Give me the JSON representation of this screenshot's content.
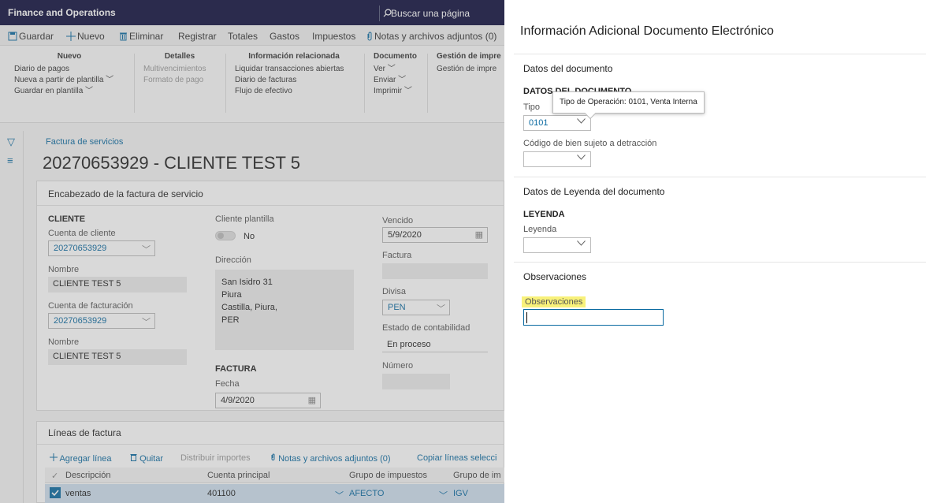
{
  "topbar": {
    "app_title": "Finance and Operations",
    "search_placeholder": "Buscar una página"
  },
  "actionbar": {
    "save": "Guardar",
    "new": "Nuevo",
    "delete": "Eliminar",
    "register": "Registrar",
    "totals": "Totales",
    "expenses": "Gastos",
    "taxes": "Impuestos",
    "notes": "Notas y archivos adjuntos (0)"
  },
  "ribbon": {
    "groups": [
      {
        "header": "Nuevo",
        "items": [
          "Diario de pagos",
          "Nueva a partir de plantilla ﹀",
          "Guardar en plantilla ﹀"
        ]
      },
      {
        "header": "Detalles",
        "items": [
          "Multivencimientos",
          "Formato de pago"
        ]
      },
      {
        "header": "Información relacionada",
        "items": [
          "Liquidar transacciones abiertas",
          "Diario de facturas",
          "Flujo de efectivo"
        ]
      },
      {
        "header": "Documento",
        "items": [
          "Ver ﹀",
          "Enviar ﹀",
          "Imprimir ﹀"
        ]
      },
      {
        "header": "Gestión de impre",
        "items": [
          "Gestión de impre"
        ]
      }
    ]
  },
  "page": {
    "breadcrumb": "Factura de servicios",
    "title": "20270653929 - CLIENTE TEST 5"
  },
  "header_card": {
    "title": "Encabezado de la factura de servicio",
    "cliente_section": "CLIENTE",
    "cuenta_cliente_label": "Cuenta de cliente",
    "cuenta_cliente_value": "20270653929",
    "nombre_label": "Nombre",
    "nombre_value": "CLIENTE TEST 5",
    "cuenta_facturacion_label": "Cuenta de facturación",
    "cuenta_facturacion_value": "20270653929",
    "nombre2_label": "Nombre",
    "nombre2_value": "CLIENTE TEST 5",
    "cliente_plantilla_label": "Cliente plantilla",
    "cliente_plantilla_value": "No",
    "direccion_label": "Dirección",
    "direccion_lines": [
      "San Isidro 31",
      "Piura",
      "Castilla, Piura,",
      "PER"
    ],
    "factura_section": "FACTURA",
    "fecha_label": "Fecha",
    "fecha_value": "4/9/2020",
    "vencido_label": "Vencido",
    "vencido_value": "5/9/2020",
    "factura_label": "Factura",
    "divisa_label": "Divisa",
    "divisa_value": "PEN",
    "estado_label": "Estado de contabilidad",
    "estado_value": "En proceso",
    "numero_label": "Número"
  },
  "lines_card": {
    "title": "Líneas de factura",
    "actions": {
      "add": "Agregar línea",
      "remove": "Quitar",
      "distribute": "Distribuir importes",
      "notes": "Notas y archivos adjuntos (0)",
      "copy": "Copiar líneas selecci"
    },
    "columns": [
      "Descripción",
      "Cuenta principal",
      "Grupo de impuestos",
      "Grupo de im"
    ],
    "rows": [
      {
        "descripcion": "ventas",
        "cuenta": "401100",
        "grupo_impuestos": "AFECTO",
        "grupo_im": "IGV"
      }
    ]
  },
  "panel": {
    "title": "Información Adicional Documento Electrónico",
    "datos_documento": "Datos del documento",
    "datos_documento_group": "DATOS DEL DOCUMENTO",
    "tipo_label": "Tipo",
    "tipo_value": "0101",
    "tooltip": "Tipo de Operación: 0101, Venta Interna",
    "codigo_label": "Código de bien sujeto a detracción",
    "codigo_value": "",
    "leyenda_section": "Datos de Leyenda del documento",
    "leyenda_group": "LEYENDA",
    "leyenda_label": "Leyenda",
    "leyenda_value": "",
    "observaciones_section": "Observaciones",
    "observaciones_label": "Observaciones",
    "observaciones_value": ""
  },
  "colors": {
    "topbar": "#0f0f3e",
    "accent": "#0a6aa1",
    "highlight": "#f8f17a",
    "row_selected": "#cfe0ef"
  }
}
